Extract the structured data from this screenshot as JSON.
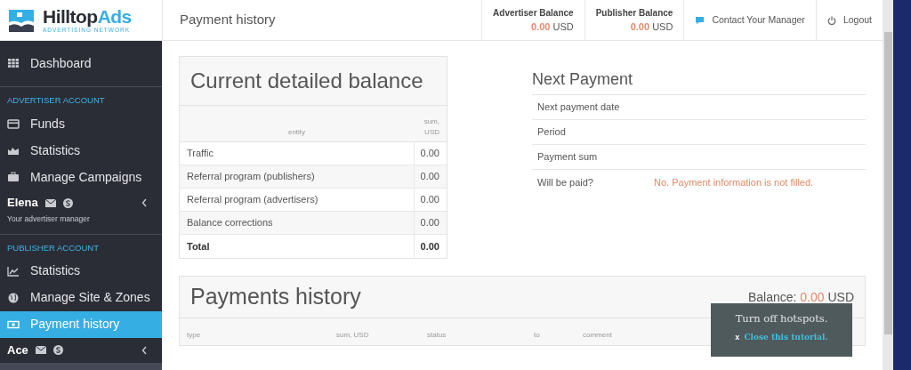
{
  "logo": {
    "brand": "Hilltop",
    "brand_accent": "Ads",
    "tagline": "ADVERTISING NETWORK"
  },
  "header": {
    "title": "Payment history",
    "balances": [
      {
        "label": "Advertiser Balance",
        "amount": "0.00",
        "currency": "USD"
      },
      {
        "label": "Publisher Balance",
        "amount": "0.00",
        "currency": "USD"
      }
    ],
    "contact": "Contact Your Manager",
    "logout": "Logout"
  },
  "sidebar": {
    "items": [
      {
        "kind": "item",
        "label": "Dashboard",
        "selected": false
      },
      {
        "kind": "section",
        "label": "ADVERTISER ACCOUNT"
      },
      {
        "kind": "item",
        "label": "Funds",
        "selected": false
      },
      {
        "kind": "item",
        "label": "Statistics",
        "selected": false
      },
      {
        "kind": "item",
        "label": "Manage Campaigns",
        "selected": false
      },
      {
        "kind": "manager",
        "name": "Elena",
        "subtitle": "Your advertiser manager"
      },
      {
        "kind": "section",
        "label": "PUBLISHER ACCOUNT"
      },
      {
        "kind": "item",
        "label": "Statistics",
        "selected": false
      },
      {
        "kind": "item",
        "label": "Manage Site & Zones",
        "selected": false
      },
      {
        "kind": "item",
        "label": "Payment history",
        "selected": true
      },
      {
        "kind": "manager",
        "name": "Ace"
      }
    ]
  },
  "balance": {
    "title": "Current detailed balance",
    "columns": [
      "entity",
      "sum, USD"
    ],
    "rows": [
      {
        "entity": "Traffic",
        "sum": "0.00",
        "total": false
      },
      {
        "entity": "Referral program (publishers)",
        "sum": "0.00",
        "total": false
      },
      {
        "entity": "Referral program (advertisers)",
        "sum": "0.00",
        "total": false
      },
      {
        "entity": "Balance corrections",
        "sum": "0.00",
        "total": false
      },
      {
        "entity": "Total",
        "sum": "0.00",
        "total": true
      }
    ]
  },
  "next_payment": {
    "title": "Next Payment",
    "rows": [
      {
        "label": "Next payment date"
      },
      {
        "label": "Period"
      },
      {
        "label": "Payment sum"
      },
      {
        "label": "Will be paid?",
        "value": "No. Payment information is not filled."
      }
    ]
  },
  "payments_history": {
    "title": "Payments history",
    "balance_label": "Balance:",
    "balance_amount": "0.00",
    "balance_currency": "USD",
    "columns": [
      "type",
      "sum, USD",
      "status",
      "to",
      "comment"
    ]
  },
  "tutorial": {
    "title": "Turn off hotspots.",
    "close_mark": "x",
    "close_link": "Close this tutorial."
  }
}
